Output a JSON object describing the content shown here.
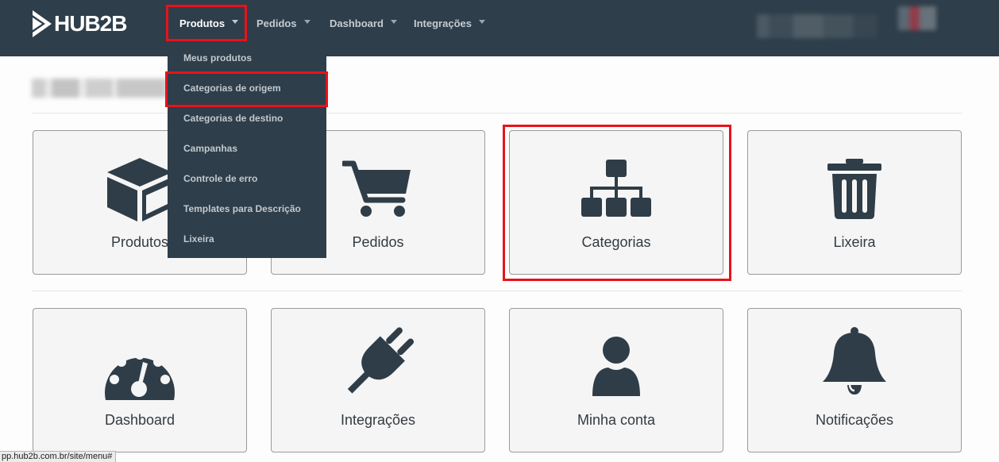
{
  "app": {
    "logo_text": "HUB2B"
  },
  "nav": {
    "items": [
      {
        "label": "Produtos",
        "active": true
      },
      {
        "label": "Pedidos",
        "active": false
      },
      {
        "label": "Dashboard",
        "active": false
      },
      {
        "label": "Integrações",
        "active": false
      }
    ]
  },
  "dropdown": {
    "items": [
      "Meus produtos",
      "Categorias de origem",
      "Categorias de destino",
      "Campanhas",
      "Controle de erro",
      "Templates para Descrição",
      "Lixeira"
    ]
  },
  "cards": [
    {
      "label": "Produtos",
      "icon": "box-icon"
    },
    {
      "label": "Pedidos",
      "icon": "shopping-cart-icon"
    },
    {
      "label": "Categorias",
      "icon": "sitemap-icon"
    },
    {
      "label": "Lixeira",
      "icon": "trash-icon"
    },
    {
      "label": "Dashboard",
      "icon": "tachometer-icon"
    },
    {
      "label": "Integrações",
      "icon": "plug-icon"
    },
    {
      "label": "Minha conta",
      "icon": "user-icon"
    },
    {
      "label": "Notificações",
      "icon": "bell-icon"
    }
  ],
  "status_bar": {
    "url": "pp.hub2b.com.br/site/menu#"
  },
  "colors": {
    "navbar": "#2e3e4a",
    "icon": "#2f3d48",
    "highlight": "#e8121a",
    "card_bg": "#f5f5f5"
  }
}
